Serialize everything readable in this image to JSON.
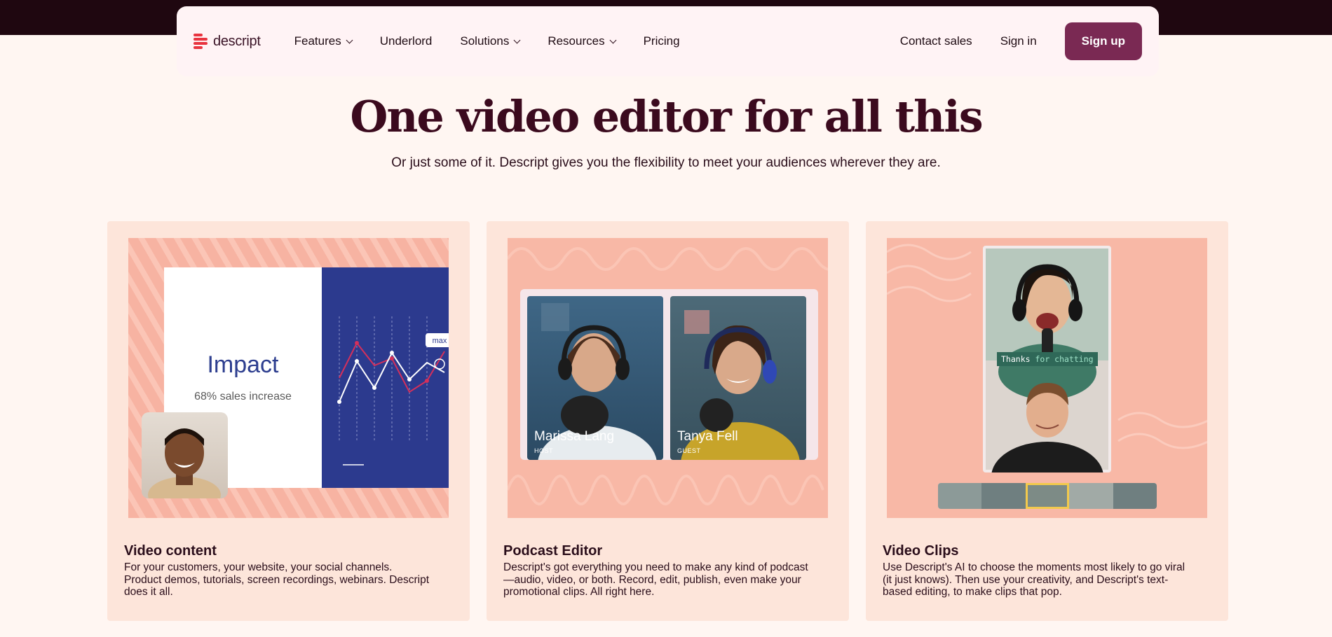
{
  "brand": {
    "name": "descript",
    "accent": "#7a2953",
    "logo_red": "#e8343f"
  },
  "nav": {
    "items": [
      {
        "label": "Features",
        "dropdown": true
      },
      {
        "label": "Underlord",
        "dropdown": false
      },
      {
        "label": "Solutions",
        "dropdown": true
      },
      {
        "label": "Resources",
        "dropdown": true
      },
      {
        "label": "Pricing",
        "dropdown": false
      }
    ],
    "contact_sales": "Contact sales",
    "sign_in": "Sign in",
    "sign_up": "Sign up"
  },
  "hero": {
    "title": "One video editor for all this",
    "subtitle": "Or just some of it. Descript gives you the flexibility to meet your audiences wherever they are."
  },
  "cards": [
    {
      "title": "Video content",
      "description": "For your customers, your website, your social channels. Product demos, tutorials, screen recordings, webinars. Descript does it all.",
      "slide_title": "Impact",
      "slide_stat": "68% sales increase",
      "chart_tooltip": "max"
    },
    {
      "title": "Podcast Editor",
      "description": "Descript's got everything you need to make any kind of podcast—audio, video, or both. Record, edit, publish, even make your promotional clips. All right here.",
      "host_name": "Marissa Lang",
      "host_role": "HOST",
      "guest_name": "Tanya Fell",
      "guest_role": "GUEST"
    },
    {
      "title": "Video Clips",
      "description": "Use Descript's AI to choose the moments most likely to go viral (it just knows). Then use your creativity, and Descript's text-based editing, to make clips that pop.",
      "caption_word_1": "Thanks",
      "caption_word_2": "for chatting"
    }
  ]
}
